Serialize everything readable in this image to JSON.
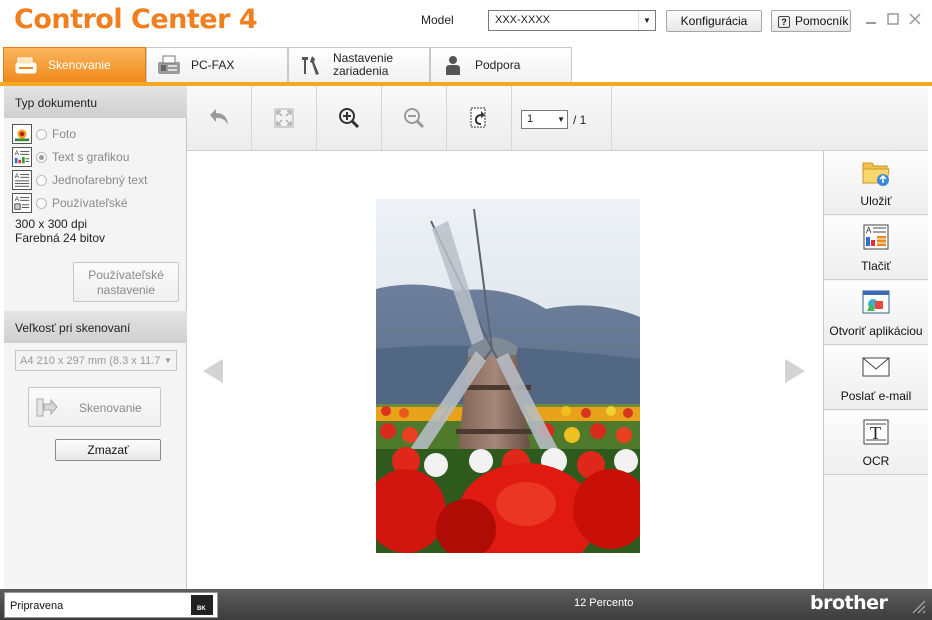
{
  "window": {
    "title_part1": "Control",
    "title_part2": "Center 4",
    "model_label": "Model",
    "model_value": "XXX-XXXX",
    "config_button": "Konfigurácia",
    "help_button": "Pomocník",
    "brand_color": "#f07f1f"
  },
  "tabs": [
    {
      "label": "Skenovanie",
      "icon": "scanner-icon",
      "active": true
    },
    {
      "label": "PC-FAX",
      "icon": "fax-icon",
      "active": false
    },
    {
      "label": "Nastavenie zariadenia",
      "icon": "tools-icon",
      "active": false
    },
    {
      "label": "Podpora",
      "icon": "person-icon",
      "active": false
    }
  ],
  "left_panel": {
    "doc_type_header": "Typ dokumentu",
    "doc_types": [
      {
        "label": "Foto",
        "icon": "photo-doc-icon",
        "selected": false
      },
      {
        "label": "Text s grafikou",
        "icon": "text-graphics-doc-icon",
        "selected": true
      },
      {
        "label": "Jednofarebný text",
        "icon": "mono-text-doc-icon",
        "selected": false
      },
      {
        "label": "Používateľské",
        "icon": "custom-doc-icon",
        "selected": false
      }
    ],
    "resolution": "300 x 300 dpi",
    "color_mode": "Farebná 24 bitov",
    "custom_settings_button": "Používateľské nastavenie",
    "scan_size_header": "Veľkosť pri skenovaní",
    "scan_size_value": "A4 210 x 297 mm (8.3 x 11.7",
    "scan_button": "Skenovanie",
    "clear_button": "Zmazať"
  },
  "toolbar": {
    "tools": [
      "undo-icon",
      "fit-to-window-icon",
      "zoom-in-icon",
      "zoom-out-icon",
      "rotate-icon"
    ],
    "page_current": "1",
    "page_total": "/ 1"
  },
  "actions": [
    {
      "label": "Uložiť",
      "icon": "save-folder-icon"
    },
    {
      "label": "Tlačiť",
      "icon": "print-icon"
    },
    {
      "label": "Otvoriť aplikáciou",
      "icon": "open-app-icon"
    },
    {
      "label": "Poslať e-mail",
      "icon": "email-icon"
    },
    {
      "label": "OCR",
      "icon": "ocr-icon"
    }
  ],
  "status": {
    "state": "Pripravena",
    "ink_label": "BK",
    "zoom": "12 Percento",
    "brand": "brother"
  }
}
